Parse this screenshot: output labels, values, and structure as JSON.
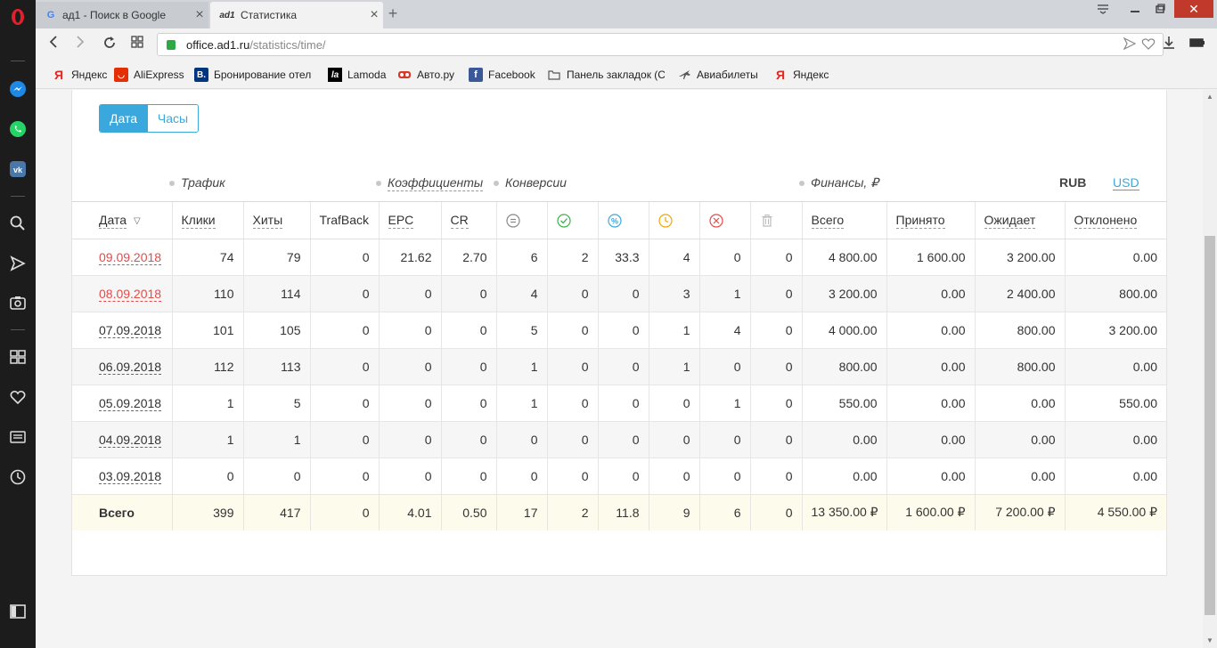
{
  "browser": {
    "tabs": [
      {
        "title": "ад1 - Поиск в Google",
        "favicon": "google-icon"
      },
      {
        "title": "Статистика",
        "favicon": "ad1-icon"
      }
    ],
    "url": {
      "host": "office.ad1.ru",
      "path": "/statistics/time/"
    },
    "bookmarks": [
      {
        "label": "Яндекс",
        "icon": "yandex-icon"
      },
      {
        "label": "AliExpress",
        "icon": "aliexpress-icon"
      },
      {
        "label": "Бронирование отел",
        "icon": "booking-icon"
      },
      {
        "label": "Lamoda",
        "icon": "lamoda-icon"
      },
      {
        "label": "Авто.ру",
        "icon": "autoru-icon"
      },
      {
        "label": "Facebook",
        "icon": "facebook-icon"
      },
      {
        "label": "Панель закладок (Ch",
        "icon": "folder-icon"
      },
      {
        "label": "Авиабилеты",
        "icon": "plane-icon"
      },
      {
        "label": "Яндекс",
        "icon": "yandex-icon"
      }
    ]
  },
  "toggle": {
    "date": "Дата",
    "hours": "Часы"
  },
  "groups": {
    "traffic": "Трафик",
    "coefficients": "Коэффициенты",
    "conversions": "Конверсии",
    "finance": "Финансы, ₽"
  },
  "currency": {
    "rub": "RUB",
    "usd": "USD"
  },
  "columns": {
    "date": "Дата",
    "clicks": "Клики",
    "hits": "Хиты",
    "trafback": "TrafBack",
    "epc": "EPC",
    "cr": "CR",
    "total": "Всего",
    "accepted": "Принято",
    "pending": "Ожидает",
    "rejected": "Отклонено"
  },
  "rows": [
    {
      "date": "09.09.2018",
      "clicks": "74",
      "hits": "79",
      "trafback": "0",
      "epc": "21.62",
      "cr": "2.70",
      "c1": "6",
      "c2": "2",
      "c3": "33.3",
      "c4": "4",
      "c5": "0",
      "c6": "0",
      "total": "4 800.00",
      "accepted": "1 600.00",
      "pending": "3 200.00",
      "rejected": "0.00"
    },
    {
      "date": "08.09.2018",
      "clicks": "110",
      "hits": "114",
      "trafback": "0",
      "epc": "0",
      "cr": "0",
      "c1": "4",
      "c2": "0",
      "c3": "0",
      "c4": "3",
      "c5": "1",
      "c6": "0",
      "total": "3 200.00",
      "accepted": "0.00",
      "pending": "2 400.00",
      "rejected": "800.00"
    },
    {
      "date": "07.09.2018",
      "clicks": "101",
      "hits": "105",
      "trafback": "0",
      "epc": "0",
      "cr": "0",
      "c1": "5",
      "c2": "0",
      "c3": "0",
      "c4": "1",
      "c5": "4",
      "c6": "0",
      "total": "4 000.00",
      "accepted": "0.00",
      "pending": "800.00",
      "rejected": "3 200.00"
    },
    {
      "date": "06.09.2018",
      "clicks": "112",
      "hits": "113",
      "trafback": "0",
      "epc": "0",
      "cr": "0",
      "c1": "1",
      "c2": "0",
      "c3": "0",
      "c4": "1",
      "c5": "0",
      "c6": "0",
      "total": "800.00",
      "accepted": "0.00",
      "pending": "800.00",
      "rejected": "0.00"
    },
    {
      "date": "05.09.2018",
      "clicks": "1",
      "hits": "5",
      "trafback": "0",
      "epc": "0",
      "cr": "0",
      "c1": "1",
      "c2": "0",
      "c3": "0",
      "c4": "0",
      "c5": "1",
      "c6": "0",
      "total": "550.00",
      "accepted": "0.00",
      "pending": "0.00",
      "rejected": "550.00"
    },
    {
      "date": "04.09.2018",
      "clicks": "1",
      "hits": "1",
      "trafback": "0",
      "epc": "0",
      "cr": "0",
      "c1": "0",
      "c2": "0",
      "c3": "0",
      "c4": "0",
      "c5": "0",
      "c6": "0",
      "total": "0.00",
      "accepted": "0.00",
      "pending": "0.00",
      "rejected": "0.00"
    },
    {
      "date": "03.09.2018",
      "clicks": "0",
      "hits": "0",
      "trafback": "0",
      "epc": "0",
      "cr": "0",
      "c1": "0",
      "c2": "0",
      "c3": "0",
      "c4": "0",
      "c5": "0",
      "c6": "0",
      "total": "0.00",
      "accepted": "0.00",
      "pending": "0.00",
      "rejected": "0.00"
    }
  ],
  "totals": {
    "label": "Всего",
    "clicks": "399",
    "hits": "417",
    "trafback": "0",
    "epc": "4.01",
    "cr": "0.50",
    "c1": "17",
    "c2": "2",
    "c3": "11.8",
    "c4": "9",
    "c5": "6",
    "c6": "0",
    "total": "13 350.00 ₽",
    "accepted": "1 600.00 ₽",
    "pending": "7 200.00 ₽",
    "rejected": "4 550.00 ₽"
  },
  "colors": {
    "accent": "#3aa8dc",
    "date_red": "#e44b4b",
    "totals_bg": "#fdfbec"
  }
}
